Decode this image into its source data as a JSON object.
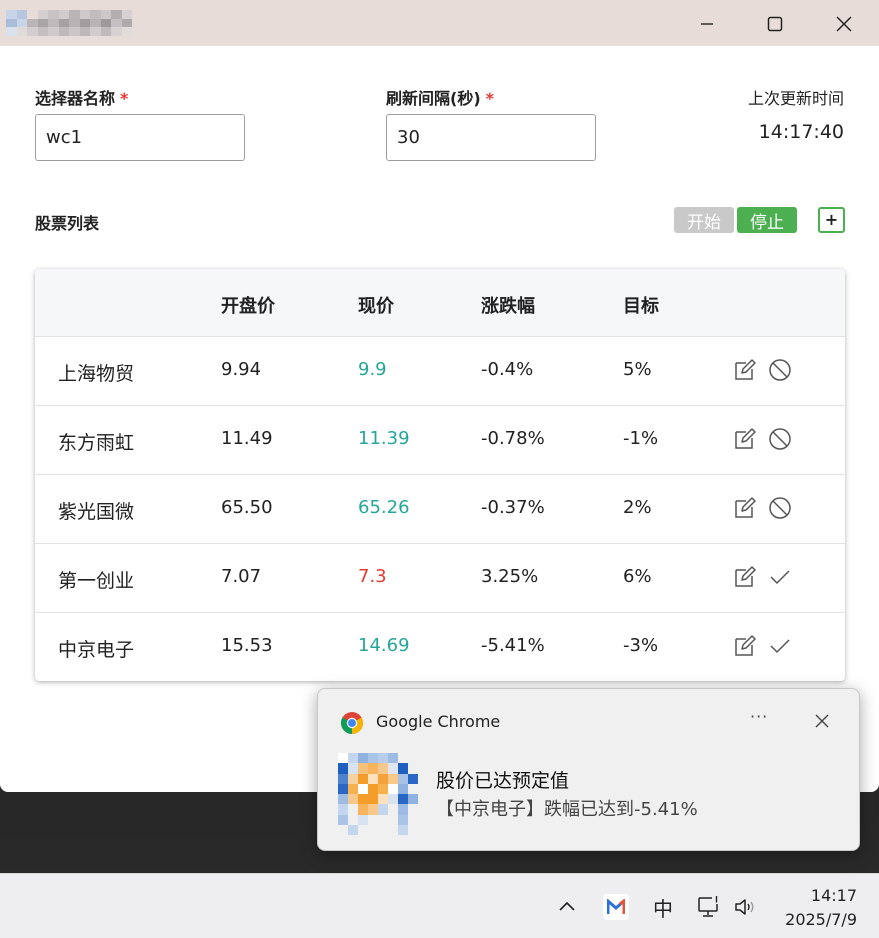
{
  "form": {
    "selector_label": "选择器名称",
    "selector_required": "*",
    "selector_value": "wc1",
    "interval_label": "刷新间隔(秒)",
    "interval_required": "*",
    "interval_value": "30",
    "last_update_label": "上次更新时间",
    "last_update_value": "14:17:40"
  },
  "stock_section": {
    "title": "股票列表",
    "start_label": "开始",
    "stop_label": "停止",
    "add_label": "+"
  },
  "table": {
    "headers": [
      "",
      "开盘价",
      "现价",
      "涨跌幅",
      "目标"
    ],
    "rows": [
      {
        "name": "上海物贸",
        "open": "9.94",
        "current": "9.9",
        "current_color": "#26a69a",
        "change": "-0.4%",
        "target": "5%",
        "status_icon": "disabled-icon"
      },
      {
        "name": "东方雨虹",
        "open": "11.49",
        "current": "11.39",
        "current_color": "#26a69a",
        "change": "-0.78%",
        "target": "-1%",
        "status_icon": "disabled-icon"
      },
      {
        "name": "紫光国微",
        "open": "65.50",
        "current": "65.26",
        "current_color": "#26a69a",
        "change": "-0.37%",
        "target": "2%",
        "status_icon": "disabled-icon"
      },
      {
        "name": "第一创业",
        "open": "7.07",
        "current": "7.3",
        "current_color": "#e53935",
        "change": "3.25%",
        "target": "6%",
        "status_icon": "check-icon"
      },
      {
        "name": "中京电子",
        "open": "15.53",
        "current": "14.69",
        "current_color": "#26a69a",
        "change": "-5.41%",
        "target": "-3%",
        "status_icon": "check-icon"
      }
    ]
  },
  "notification": {
    "app_name": "Google Chrome",
    "more_label": "···",
    "title": "股价已达预定值",
    "body": "【中京电子】跌幅已达到-5.41%"
  },
  "taskbar": {
    "ime_label": "中",
    "time": "14:17",
    "date": "2025/7/9"
  },
  "colors": {
    "accent_green": "#4caf50",
    "price_down": "#26a69a",
    "price_up": "#e53935",
    "required_star": "#e53935"
  }
}
